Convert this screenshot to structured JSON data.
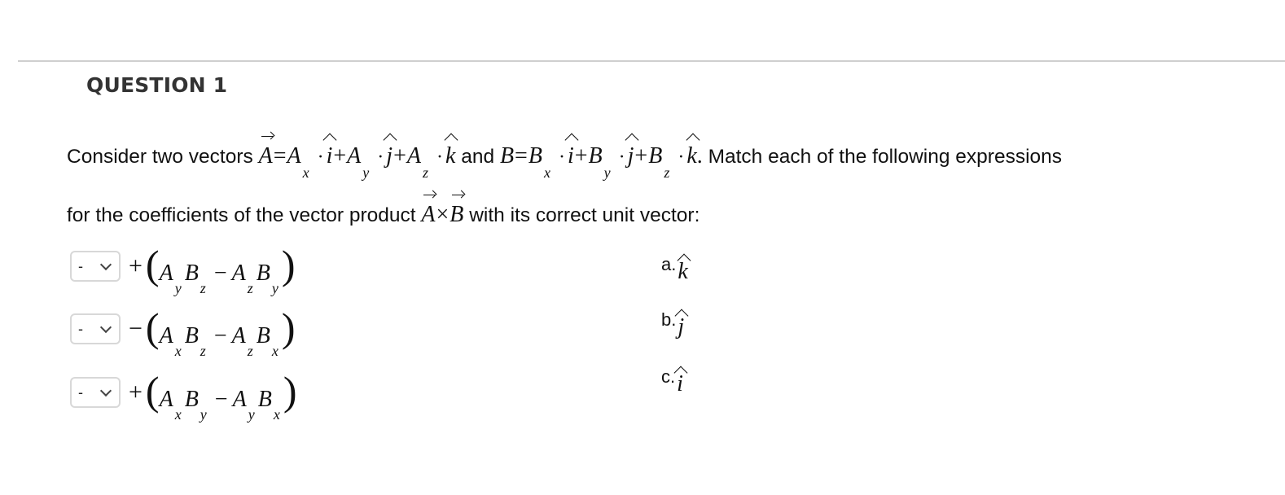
{
  "question": {
    "title": "QUESTION 1"
  },
  "stem": {
    "text_consider": "Consider two vectors",
    "text_and": "and",
    "text_match": "Match each of the following expressions",
    "text_for": "for the coefficients of the vector product",
    "text_with": "with its correct unit vector:",
    "vec_A": "A",
    "vec_B": "B",
    "var_A": "A",
    "var_B": "B",
    "sub_x": "x",
    "sub_y": "y",
    "sub_z": "z",
    "unit_i": "i",
    "unit_j": "j",
    "unit_k": "k",
    "eq": "=",
    "plus": "+",
    "cross": "×",
    "period": "."
  },
  "prompts": [
    {
      "selected": "-",
      "sign": "+",
      "terms": [
        "y",
        "z",
        "z",
        "y"
      ]
    },
    {
      "selected": "-",
      "sign": "−",
      "terms": [
        "x",
        "z",
        "z",
        "x"
      ]
    },
    {
      "selected": "-",
      "sign": "+",
      "terms": [
        "x",
        "y",
        "y",
        "x"
      ]
    }
  ],
  "answers": [
    {
      "label": "a.",
      "symbol": "k"
    },
    {
      "label": "b.",
      "symbol": "j"
    },
    {
      "label": "c.",
      "symbol": "i"
    }
  ]
}
